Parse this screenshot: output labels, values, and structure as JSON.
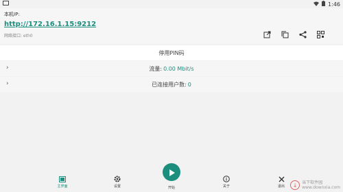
{
  "statusbar": {
    "time": "1:46"
  },
  "info": {
    "ip_label": "本机IP:",
    "ip_url": "http://172.16.1.15:9212",
    "iface": "网络接口: eth0",
    "actions": [
      "open-external-icon",
      "copy-icon",
      "share-icon",
      "qr-code-icon"
    ]
  },
  "pin_row": {
    "label": "停用PIN码"
  },
  "traffic": {
    "label": "流量:",
    "value": "0.00 Mbit/s"
  },
  "users": {
    "label": "已连接用户数:",
    "value": "0"
  },
  "nav": {
    "home": "主界面",
    "settings": "设置",
    "start": "开始",
    "about": "关于",
    "exit": "退出"
  },
  "colors": {
    "accent": "#1b8e7e"
  },
  "watermark": {
    "line1": "当下软件园",
    "line2": "www.downxia.com"
  }
}
